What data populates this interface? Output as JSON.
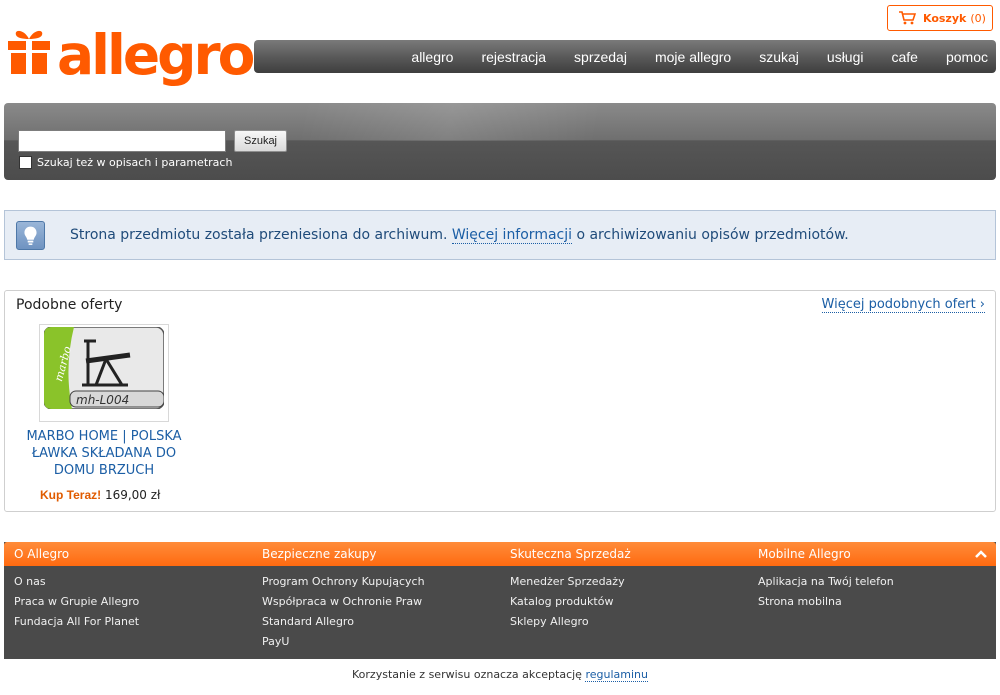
{
  "cart": {
    "label": "Koszyk",
    "count": "(0)",
    "icon": "cart-icon"
  },
  "logo": {
    "text": "allegro",
    "icon": "gift-icon"
  },
  "nav": {
    "items": [
      "allegro",
      "rejestracja",
      "sprzedaj",
      "moje allegro",
      "szukaj",
      "usługi",
      "cafe",
      "pomoc"
    ]
  },
  "search": {
    "value": "",
    "button": "Szukaj",
    "option_label": "Szukaj też w opisach i parametrach",
    "option_checked": false
  },
  "info": {
    "icon": "lightbulb-icon",
    "text_before": "Strona przedmiotu została przeniesiona do archiwum. ",
    "link": "Więcej informacji",
    "text_after": " o archiwizowaniu opisów przedmiotów."
  },
  "similar": {
    "title": "Podobne oferty",
    "more_link": "Więcej podobnych ofert ›",
    "offers": [
      {
        "name": "MARBO HOME | POLSKA ŁAWKA SKŁADANA DO DOMU BRZUCH",
        "buy_label": "Kup Teraz!",
        "price": "169,00 zł",
        "image_text": "mh-L004",
        "image_brand": "marbo"
      }
    ]
  },
  "footer": {
    "columns": [
      {
        "title": "O Allegro",
        "links": [
          "O nas",
          "Praca w Grupie Allegro",
          "Fundacja All For Planet"
        ]
      },
      {
        "title": "Bezpieczne zakupy",
        "links": [
          "Program Ochrony Kupujących",
          "Współpraca w Ochronie Praw",
          "Standard Allegro",
          "PayU"
        ]
      },
      {
        "title": "Skuteczna Sprzedaż",
        "links": [
          "Menedżer Sprzedaży",
          "Katalog produktów",
          "Sklepy Allegro"
        ]
      },
      {
        "title": "Mobilne Allegro",
        "links": [
          "Aplikacja na Twój telefon",
          "Strona mobilna"
        ]
      }
    ],
    "toggle_icon": "chevron-up-icon",
    "terms_text": "Korzystanie z serwisu oznacza akceptację ",
    "terms_link": "regulaminu"
  },
  "colors": {
    "accent": "#ff5a00",
    "link": "#1b5ea5",
    "info_bg": "#e7edf5",
    "footer_bg": "#4a4a4a"
  }
}
